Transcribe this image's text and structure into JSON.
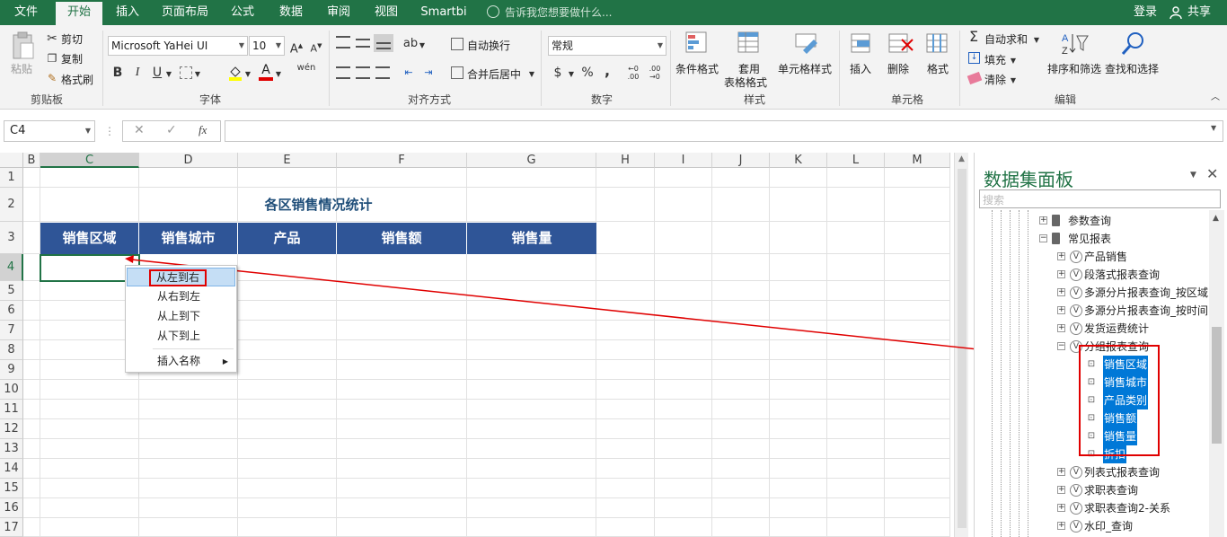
{
  "menu": {
    "tabs": [
      "文件",
      "开始",
      "插入",
      "页面布局",
      "公式",
      "数据",
      "审阅",
      "视图",
      "Smartbi"
    ],
    "active_index": 1,
    "tell_me": "告诉我您想要做什么...",
    "login": "登录",
    "share": "共享"
  },
  "ribbon": {
    "clipboard": {
      "paste": "粘贴",
      "cut": "剪切",
      "copy": "复制",
      "format_painter": "格式刷",
      "label": "剪贴板"
    },
    "font": {
      "name": "Microsoft YaHei UI",
      "size": "10",
      "label": "字体",
      "bold": "B",
      "italic": "I",
      "underline": "U",
      "font_color_letter": "A",
      "wen": "wén"
    },
    "alignment": {
      "wrap": "自动换行",
      "merge": "合并后居中",
      "label": "对齐方式"
    },
    "number": {
      "format": "常规",
      "label": "数字",
      "currency": "$",
      "percent": "%",
      "comma": ","
    },
    "styles": {
      "conditional": "条件格式",
      "table1": "套用",
      "table2": "表格格式",
      "cell_styles": "单元格样式",
      "label": "样式"
    },
    "cells": {
      "insert": "插入",
      "delete": "删除",
      "format": "格式",
      "label": "单元格"
    },
    "editing": {
      "autosum": "自动求和",
      "fill": "填充",
      "clear": "清除",
      "sort": "排序和筛选",
      "find": "查找和选择",
      "label": "编辑"
    }
  },
  "formula_bar": {
    "name_box": "C4",
    "fx": "fx",
    "value": ""
  },
  "sheet": {
    "columns": [
      "B",
      "C",
      "D",
      "E",
      "F",
      "G",
      "H",
      "I",
      "J",
      "K",
      "L",
      "M"
    ],
    "rows": [
      "1",
      "2",
      "3",
      "4",
      "5",
      "6",
      "7",
      "8",
      "9",
      "10",
      "11",
      "12",
      "13",
      "14",
      "15",
      "16",
      "17"
    ],
    "title": "各区销售情况统计",
    "headers": [
      "销售区域",
      "销售城市",
      "产品",
      "销售额",
      "销售量"
    ]
  },
  "context_menu": {
    "items": [
      "从左到右",
      "从右到左",
      "从上到下",
      "从下到上"
    ],
    "insert_name": "插入名称"
  },
  "panel": {
    "title": "数据集面板",
    "search_placeholder": "搜索",
    "nodes": {
      "param": "参数查询",
      "common": "常见报表",
      "product_sales": "产品销售",
      "paragraph": "段落式报表查询",
      "multi1": "多源分片报表查询_按区域",
      "multi2": "多源分片报表查询_按时间",
      "shipping": "发货运费统计",
      "group": "分组报表查询",
      "list": "列表式报表查询",
      "job1": "求职表查询",
      "job2": "求职表查询2-关系",
      "watermark": "水印_查询"
    },
    "fields": [
      "销售区域",
      "销售城市",
      "产品类别",
      "销售额",
      "销售量",
      "折扣"
    ]
  },
  "colors": {
    "excel_green": "#217346",
    "header_blue": "#2f5597",
    "select_blue": "#0078d7",
    "highlight_red": "#e00000"
  }
}
